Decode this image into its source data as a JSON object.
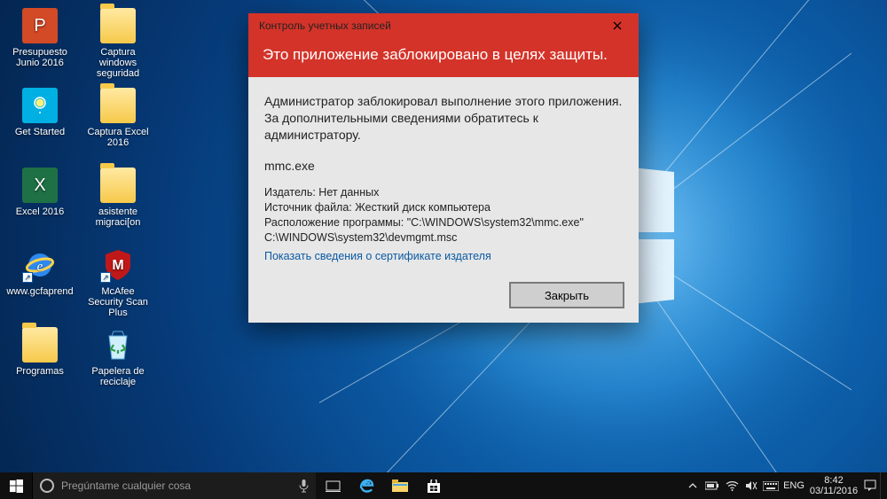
{
  "desktop_icons": [
    {
      "label": "Presupuesto Junio 2016",
      "type": "powerpoint"
    },
    {
      "label": "Captura windows seguridad",
      "type": "folder"
    },
    {
      "label": "Get Started",
      "type": "getstarted"
    },
    {
      "label": "Captura Excel 2016",
      "type": "folder"
    },
    {
      "label": "Excel 2016",
      "type": "excel"
    },
    {
      "label": "asistente migraci[on",
      "type": "folder"
    },
    {
      "label": "www.gcfaprend",
      "type": "ie"
    },
    {
      "label": "McAfee Security Scan Plus",
      "type": "mcafee"
    },
    {
      "label": "Programas",
      "type": "folder"
    },
    {
      "label": "Papelera de reciclaje",
      "type": "recycle"
    }
  ],
  "uac": {
    "titlebar": "Контроль учетных записей",
    "header": "Это приложение заблокировано в целях защиты.",
    "message": "Администратор заблокировал выполнение этого приложения. За дополнительными сведениями обратитесь к администратору.",
    "exe": "mmc.exe",
    "publisher_label": "Издатель:",
    "publisher_value": "Нет данных",
    "source_label": "Источник файла:",
    "source_value": "Жесткий диск компьютера",
    "location_label": "Расположение программы:",
    "location_value": "\"C:\\WINDOWS\\system32\\mmc.exe\" C:\\WINDOWS\\system32\\devmgmt.msc",
    "cert_link": "Показать сведения о сертификате издателя",
    "close_button": "Закрыть"
  },
  "taskbar": {
    "search_placeholder": "Pregúntame cualquier cosa",
    "lang": "ENG",
    "time": "8:42",
    "date": "03/11/2016"
  }
}
